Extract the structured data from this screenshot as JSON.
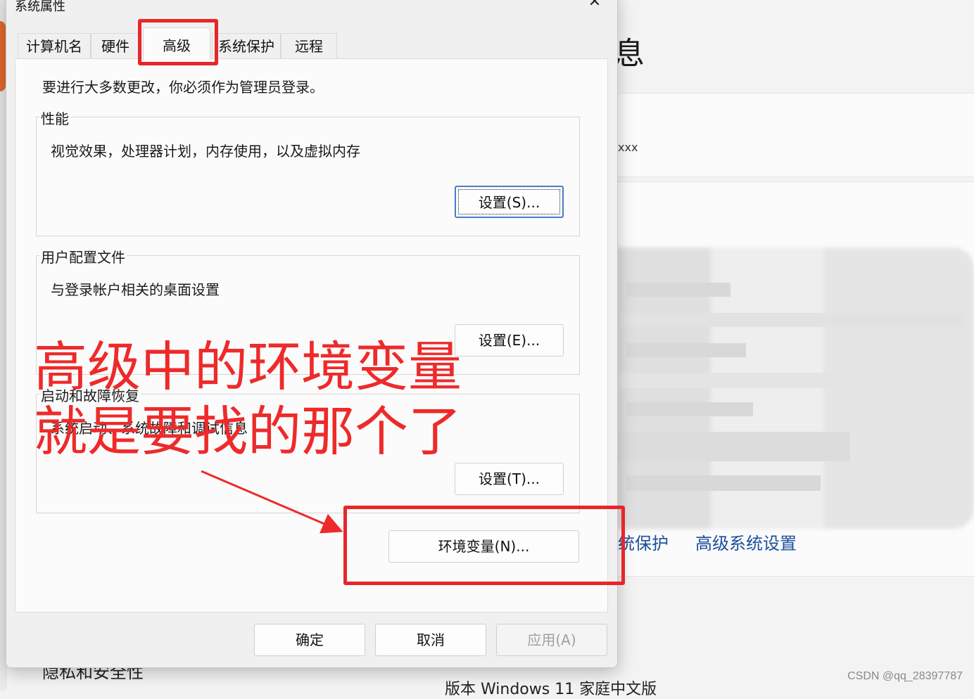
{
  "dialog": {
    "title": "系统属性",
    "close_glyph": "✕",
    "tabs": [
      {
        "label": "计算机名"
      },
      {
        "label": "硬件"
      },
      {
        "label": "高级"
      },
      {
        "label": "系统保护"
      },
      {
        "label": "远程"
      }
    ],
    "admin_note": "要进行大多数更改，你必须作为管理员登录。",
    "performance": {
      "title": "性能",
      "desc": "视觉效果，处理器计划，内存使用，以及虚拟内存",
      "button": "设置(S)..."
    },
    "profiles": {
      "title": "用户配置文件",
      "desc": "与登录帐户相关的桌面设置",
      "button": "设置(E)..."
    },
    "startup": {
      "title": "启动和故障恢复",
      "desc": "系统启动、系统故障和调试信息",
      "button": "设置(T)..."
    },
    "env_button": "环境变量(N)...",
    "ok": "确定",
    "cancel": "取消",
    "apply": "应用(A)"
  },
  "annotation": {
    "line1": "高级中的环境变量",
    "line2": "就是要找的那个了",
    "color": "#ee2a2a"
  },
  "background": {
    "heading_fragment": "息",
    "device_value": "xxx",
    "link_system_protection": "统保护",
    "link_advanced_settings": "高级系统设置",
    "sidebar_item": "隐私和安全性",
    "edition_row": "版本      Windows 11 家庭中文版"
  },
  "watermark": "CSDN @qq_28397787"
}
